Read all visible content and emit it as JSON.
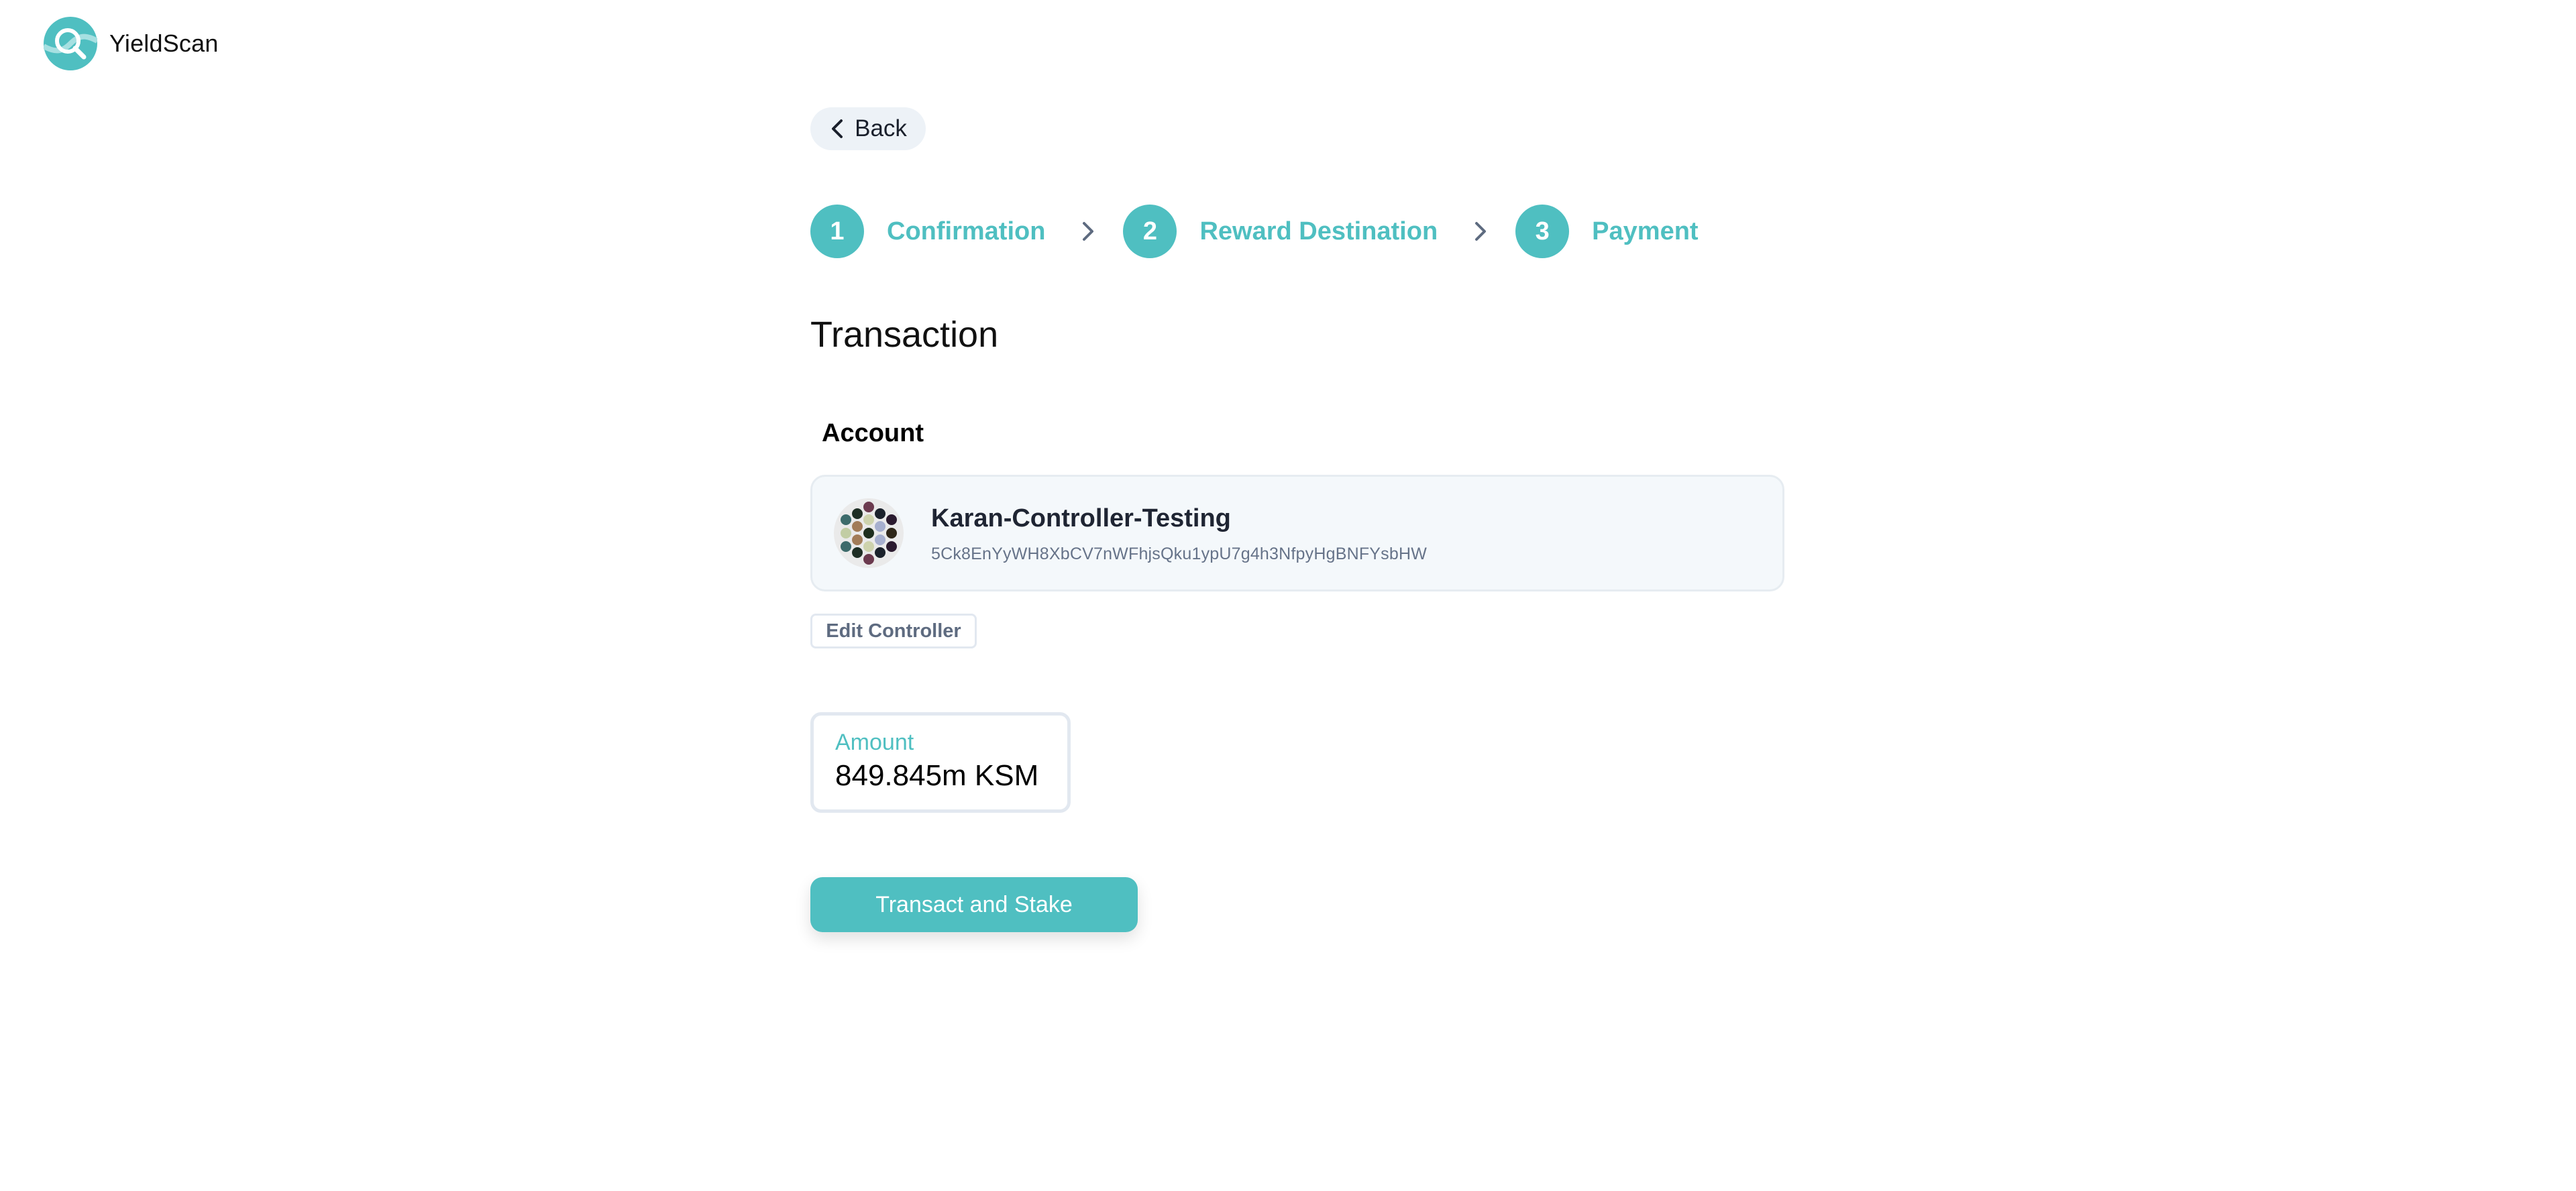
{
  "app": {
    "name": "YieldScan",
    "logo_icon": "magnifier-wave-logo"
  },
  "colors": {
    "accent": "#4FBFC1",
    "card_bg": "#F4F8FB",
    "muted_text": "#667389",
    "back_bg": "#EDF2F7"
  },
  "nav": {
    "back_label": "Back",
    "back_icon": "chevron-left-icon"
  },
  "stepper": {
    "separator_icon": "chevron-right-icon",
    "steps": [
      {
        "number": "1",
        "label": "Confirmation"
      },
      {
        "number": "2",
        "label": "Reward Destination"
      },
      {
        "number": "3",
        "label": "Payment"
      }
    ]
  },
  "main": {
    "title": "Transaction",
    "account_section_label": "Account",
    "account": {
      "name": "Karan-Controller-Testing",
      "address": "5Ck8EnYyWH8XbCV7nWFhjsQku1ypU7g4h3NfpyHgBNFYsbHW",
      "avatar_icon": "identicon-avatar"
    },
    "edit_controller_label": "Edit Controller",
    "amount": {
      "label": "Amount",
      "value": "849.845m KSM"
    },
    "submit_label": "Transact and Stake"
  }
}
